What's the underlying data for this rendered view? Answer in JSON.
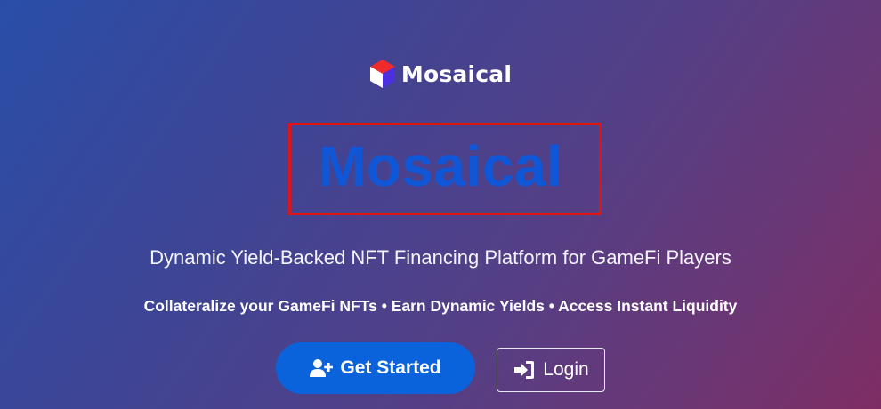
{
  "brand": {
    "name": "Mosaical",
    "logo_icon": "cube-logo-icon"
  },
  "hero": {
    "title": "Mosaical",
    "title_color": "#0f57d6",
    "frame_color": "#e01414"
  },
  "subtitle": "Dynamic Yield-Backed NFT Financing Platform for GameFi Players",
  "features": "Collateralize your GameFi NFTs • Earn Dynamic Yields • Access Instant Liquidity",
  "actions": {
    "get_started": {
      "label": "Get Started",
      "icon": "user-plus-icon",
      "color": "#0b63dc"
    },
    "login": {
      "label": "Login",
      "icon": "sign-in-icon"
    }
  }
}
